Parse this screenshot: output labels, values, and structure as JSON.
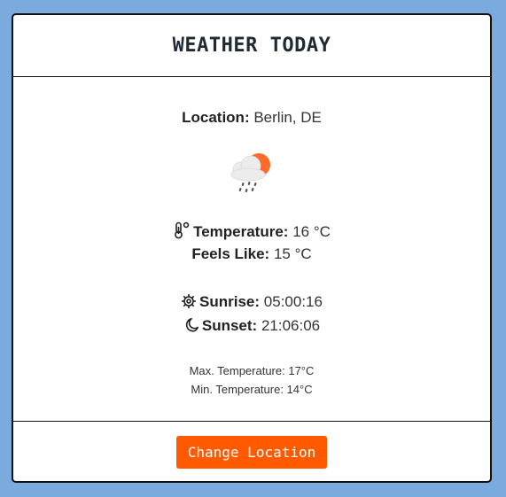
{
  "header": {
    "title": "WEATHER TODAY"
  },
  "weather": {
    "location_label": "Location:",
    "location_value": "Berlin, DE",
    "condition_icon": "rain-cloud-sun-icon",
    "temperature_label": "Temperature:",
    "temperature_value": "16 °C",
    "feels_like_label": "Feels Like:",
    "feels_like_value": "15 °C",
    "sunrise_label": "Sunrise:",
    "sunrise_value": "05:00:16",
    "sunset_label": "Sunset:",
    "sunset_value": "21:06:06",
    "max_temp_text": "Max. Temperature: 17°C",
    "min_temp_text": "Min. Temperature: 14°C"
  },
  "footer": {
    "change_location_label": "Change Location"
  },
  "colors": {
    "page_background": "#7aaade",
    "button": "#ff5a00",
    "sun": "#ff6a2b",
    "cloud": "#eeeeee"
  }
}
